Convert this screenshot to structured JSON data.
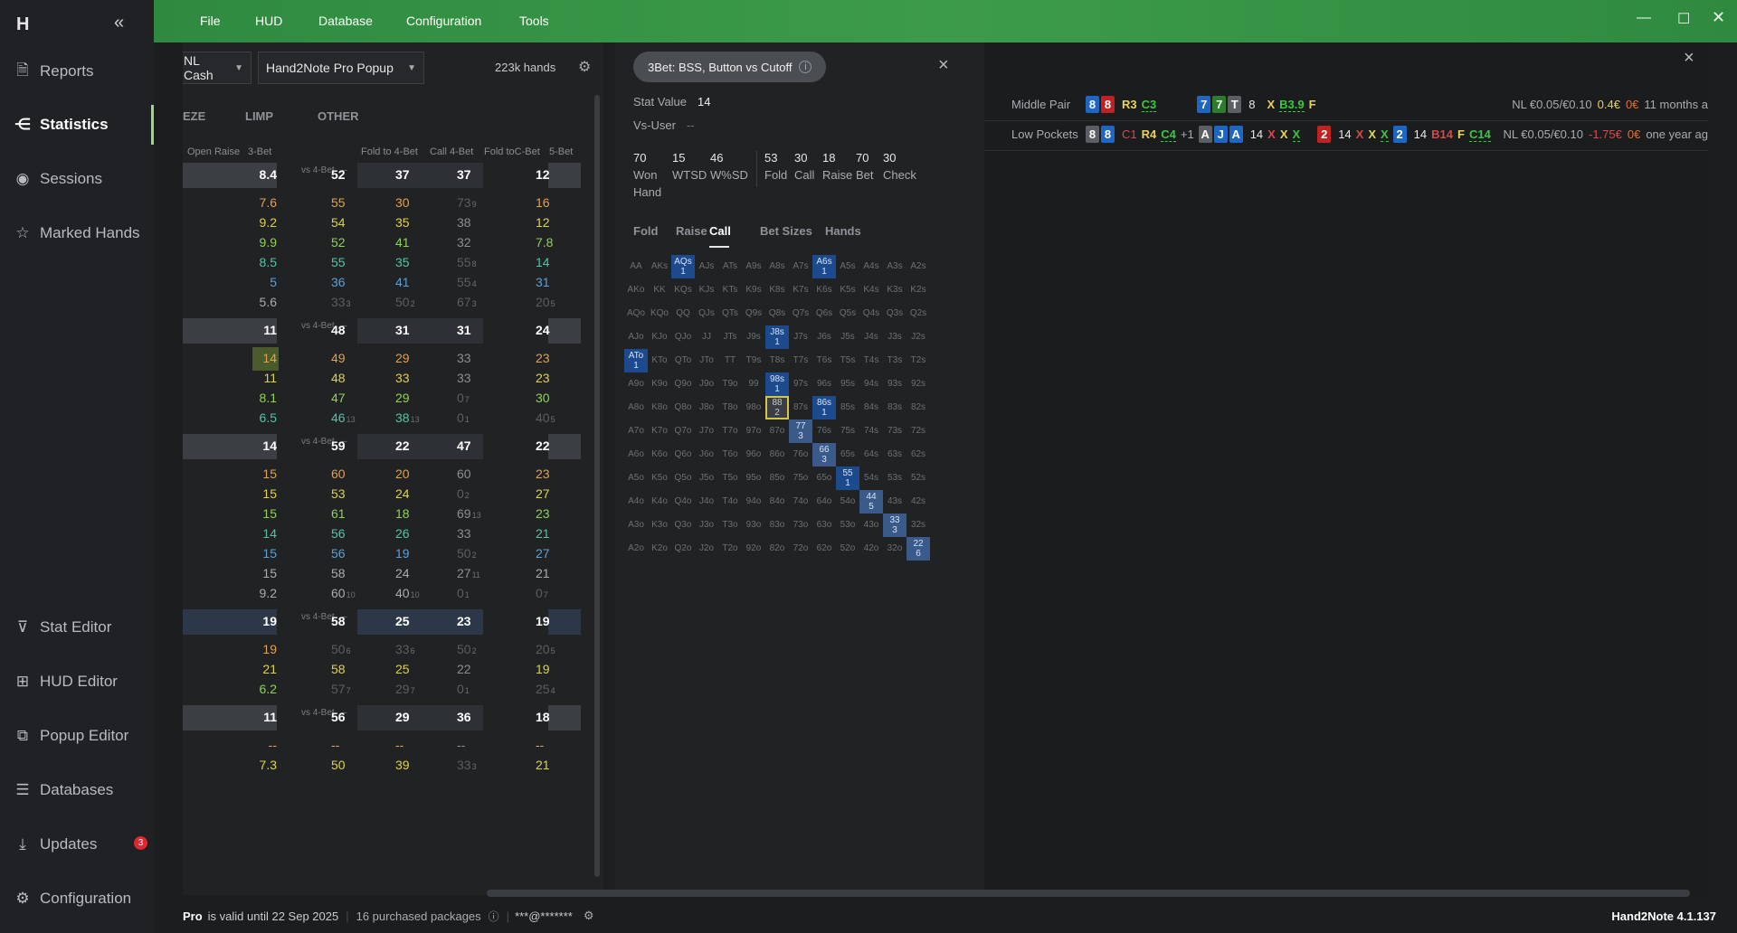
{
  "menu": [
    "File",
    "HUD",
    "Database",
    "Configuration",
    "Tools"
  ],
  "sidebar": {
    "logo": "H",
    "collapse": "«",
    "items": [
      {
        "label": "Reports",
        "icon": "reports-icon"
      },
      {
        "label": "Statistics",
        "icon": "statistics-icon"
      },
      {
        "label": "Sessions",
        "icon": "sessions-icon"
      },
      {
        "label": "Marked Hands",
        "icon": "marked-hands-icon"
      },
      {
        "label": "Stat Editor",
        "icon": "filter-icon"
      },
      {
        "label": "HUD Editor",
        "icon": "hud-editor-icon"
      },
      {
        "label": "Popup Editor",
        "icon": "popup-editor-icon"
      },
      {
        "label": "Databases",
        "icon": "database-icon"
      },
      {
        "label": "Updates",
        "icon": "download-icon",
        "badge": "3"
      },
      {
        "label": "Configuration",
        "icon": "gear-icon"
      }
    ]
  },
  "left": {
    "game_dropdown": "NL Cash",
    "popup_dropdown": "Hand2Note Pro Popup",
    "hands": "223k hands",
    "tabs": [
      "EZE",
      "LIMP",
      "OTHER"
    ],
    "col_headers": [
      "Open Raise",
      "3-Bet",
      "Fold to 4-Bet",
      "Call 4-Bet",
      "Fold toC-Bet",
      "5-Bet"
    ],
    "vs4bet": "vs 4-Bet",
    "dash": "–",
    "rows": [
      {
        "c": "8.4",
        "f": "52",
        "k": "37",
        "t": "37",
        "b": "12",
        "h": true
      },
      {
        "c": "7.6",
        "f": "55",
        "k": "30",
        "t": "73",
        "ts": "9",
        "b": "16"
      },
      {
        "c": "9.2",
        "f": "54",
        "k": "35",
        "t": "38",
        "b": "12"
      },
      {
        "c": "9.9",
        "f": "52",
        "k": "41",
        "t": "32",
        "b": "7.8"
      },
      {
        "c": "8.5",
        "f": "55",
        "k": "35",
        "t": "55",
        "ts": "8",
        "b": "14"
      },
      {
        "c": "5",
        "f": "36",
        "k": "41",
        "t": "55",
        "ts": "4",
        "b": "31"
      },
      {
        "c": "5.6",
        "f": "33",
        "fs": "3",
        "k": "50",
        "ks": "2",
        "t": "67",
        "ts": "3",
        "b": "20",
        "bs": "5"
      },
      {
        "gap": true
      },
      {
        "c": "11",
        "f": "48",
        "k": "31",
        "t": "31",
        "b": "24",
        "h": true
      },
      {
        "c": "14",
        "f": "49",
        "k": "29",
        "t": "33",
        "b": "23",
        "hl": true
      },
      {
        "c": "11",
        "f": "48",
        "k": "33",
        "t": "33",
        "b": "23"
      },
      {
        "c": "8.1",
        "f": "47",
        "k": "29",
        "t": "0",
        "ts": "7",
        "b": "30"
      },
      {
        "c": "6.5",
        "f": "46",
        "fs": "13",
        "k": "38",
        "ks": "13",
        "t": "0",
        "ts": "1",
        "b": "40",
        "bs": "5"
      },
      {
        "gap": true
      },
      {
        "c": "14",
        "f": "59",
        "k": "22",
        "t": "47",
        "b": "22",
        "h": true
      },
      {
        "c": "15",
        "f": "60",
        "k": "20",
        "t": "60",
        "b": "23"
      },
      {
        "c": "15",
        "f": "53",
        "k": "24",
        "t": "0",
        "ts": "2",
        "b": "27"
      },
      {
        "c": "15",
        "f": "61",
        "k": "18",
        "t": "69",
        "ts": "13",
        "b": "23"
      },
      {
        "c": "14",
        "f": "56",
        "k": "26",
        "t": "33",
        "b": "21"
      },
      {
        "c": "15",
        "f": "56",
        "k": "19",
        "t": "50",
        "ts": "2",
        "b": "27"
      },
      {
        "c": "15",
        "f": "58",
        "k": "24",
        "t": "27",
        "ts": "11",
        "b": "21"
      },
      {
        "c": "9.2",
        "f": "60",
        "fs": "10",
        "k": "40",
        "ks": "10",
        "t": "0",
        "ts": "1",
        "b": "0",
        "bs": "7"
      },
      {
        "gap": true
      },
      {
        "c": "19",
        "f": "58",
        "k": "25",
        "t": "23",
        "b": "19",
        "h2": true
      },
      {
        "c": "19",
        "f": "50",
        "fs": "6",
        "k": "33",
        "ks": "6",
        "t": "50",
        "ts": "2",
        "b": "20",
        "bs": "5"
      },
      {
        "c": "21",
        "f": "58",
        "k": "25",
        "t": "22",
        "b": "19"
      },
      {
        "c": "6.2",
        "f": "57",
        "fs": "7",
        "k": "29",
        "ks": "7",
        "t": "0",
        "ts": "1",
        "b": "25",
        "bs": "4"
      },
      {
        "gap": true
      },
      {
        "c": "11",
        "f": "56",
        "k": "29",
        "t": "36",
        "b": "18",
        "h": true
      },
      {
        "c": "--",
        "f": "--",
        "k": "--",
        "t": "--",
        "b": "--"
      },
      {
        "c": "7.3",
        "f": "50",
        "k": "39",
        "t": "33",
        "ts": "3",
        "b": "21"
      }
    ]
  },
  "popup": {
    "title": "3Bet: BSS, Button vs Cutoff",
    "info": "i",
    "close": "×",
    "stat_value_label": "Stat Value",
    "stat_value": "14",
    "vs_user_label": "Vs-User",
    "vs_user": "--",
    "stats": [
      {
        "v": "70",
        "l": "Won Hand"
      },
      {
        "v": "15",
        "l": "WTSD"
      },
      {
        "v": "46",
        "l": "W%SD"
      },
      {
        "v": "53",
        "l": "Fold"
      },
      {
        "v": "30",
        "l": "Call"
      },
      {
        "v": "18",
        "l": "Raise"
      },
      {
        "v": "70",
        "l": "Bet"
      },
      {
        "v": "30",
        "l": "Check"
      }
    ],
    "tabs": [
      "Fold",
      "Raise",
      "Call",
      "Bet Sizes",
      "Hands"
    ],
    "active_tab": "Call",
    "grid_special": {
      "AQs": "1",
      "A6s": "1",
      "ATo": "1",
      "J8s": "1",
      "98s": "1",
      "88": "2",
      "86s": "1",
      "77": "3",
      "66": "3",
      "55": "1",
      "44": "5",
      "33": "3",
      "22": "6"
    }
  },
  "right": {
    "close": "×",
    "hands": [
      {
        "label": "Middle Pair",
        "stake": "NL €0.05/€0.10",
        "won": "0.4€",
        "ev": "0€",
        "when": "11 months a"
      },
      {
        "label": "Low Pockets",
        "stake": "NL €0.05/€0.10",
        "won": "-1.75€",
        "ev": "0€",
        "when": "one year ag"
      }
    ]
  },
  "footer": {
    "pro": "Pro",
    "valid": "is valid until 22 Sep 2025",
    "packages": "16 purchased packages",
    "user": "***@*******",
    "version": "Hand2Note 4.1.137"
  }
}
